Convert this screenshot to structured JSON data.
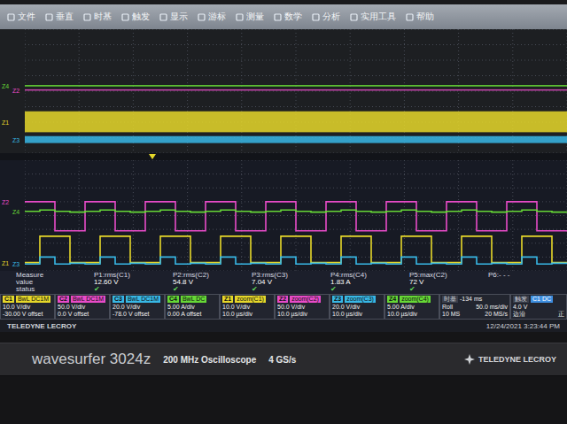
{
  "menu": [
    {
      "label": "文件"
    },
    {
      "label": "垂直"
    },
    {
      "label": "时基"
    },
    {
      "label": "触发"
    },
    {
      "label": "显示"
    },
    {
      "label": "游标"
    },
    {
      "label": "测量"
    },
    {
      "label": "数学"
    },
    {
      "label": "分析"
    },
    {
      "label": "实用工具"
    },
    {
      "label": "帮助"
    }
  ],
  "overview": {
    "series": [
      {
        "label": "Z4",
        "color": "#66d836",
        "top": 0.4,
        "bottom": 0.3
      },
      {
        "label": "Z2",
        "color": "#e84bc8",
        "top": 0.12,
        "bottom": 0.04
      },
      {
        "label": "Z1",
        "color": "#e6d82a",
        "top": -1.3,
        "bottom": -2.65
      },
      {
        "label": "Z3",
        "color": "#38b8e6",
        "top": -2.9,
        "bottom": -3.35
      }
    ]
  },
  "zoom": {
    "units": "divisions",
    "series": [
      {
        "label": "Z2",
        "color": "#e84bc8",
        "values": [
          1.0,
          1.0,
          -1.1,
          -1.1,
          1.0,
          1.0,
          -1.1,
          -1.1,
          1.0,
          1.0,
          -1.1,
          -1.1,
          1.0,
          1.0,
          -1.1,
          -1.1,
          1.0,
          1.0,
          -1.1,
          -1.1,
          1.0,
          1.0,
          -1.1,
          -1.1,
          1.0,
          1.0,
          -1.1,
          -1.1,
          1.0,
          1.0,
          -1.1,
          -1.1,
          1.0,
          1.0,
          -1.1,
          -1.1
        ]
      },
      {
        "label": "Z4",
        "color": "#66d836",
        "values": [
          0.3,
          0.4,
          0.3,
          0.25,
          0.3,
          0.4,
          0.3,
          0.25,
          0.3,
          0.4,
          0.3,
          0.25,
          0.3,
          0.4,
          0.3,
          0.25,
          0.3,
          0.4,
          0.3,
          0.25,
          0.3,
          0.4,
          0.3,
          0.25,
          0.3,
          0.4,
          0.3,
          0.25,
          0.3,
          0.4,
          0.3,
          0.25,
          0.3,
          0.4,
          0.3,
          0.25
        ]
      },
      {
        "label": "Z1",
        "color": "#e6d82a",
        "values": [
          -3.4,
          -1.5,
          -1.5,
          -3.4,
          -3.4,
          -1.5,
          -1.5,
          -3.4,
          -3.4,
          -1.5,
          -1.5,
          -3.4,
          -3.4,
          -1.5,
          -1.5,
          -3.4,
          -3.4,
          -1.5,
          -1.5,
          -3.4,
          -3.4,
          -1.5,
          -1.5,
          -3.4,
          -3.4,
          -1.5,
          -1.5,
          -3.4,
          -3.4,
          -1.5,
          -1.5,
          -3.4,
          -3.4,
          -1.5,
          -1.5,
          -3.4
        ]
      },
      {
        "label": "Z3",
        "color": "#38b8e6",
        "values": [
          -3.5,
          -3.0,
          -3.5,
          -3.45,
          -3.5,
          -3.0,
          -3.5,
          -3.45,
          -3.5,
          -3.0,
          -3.5,
          -3.45,
          -3.5,
          -3.0,
          -3.5,
          -3.45,
          -3.5,
          -3.0,
          -3.5,
          -3.45,
          -3.5,
          -3.0,
          -3.5,
          -3.45,
          -3.5,
          -3.0,
          -3.5,
          -3.45,
          -3.5,
          -3.0,
          -3.5,
          -3.45,
          -3.5,
          -3.0,
          -3.5,
          -3.45
        ]
      }
    ]
  },
  "measure": {
    "labels": [
      "Measure",
      "value",
      "status"
    ],
    "params": [
      {
        "name": "P1:rms(C1)",
        "value": "12.60 V",
        "ok": true,
        "mark": "✔"
      },
      {
        "name": "P2:rms(C2)",
        "value": "54.8 V",
        "ok": true,
        "mark": "✔"
      },
      {
        "name": "P3:rms(C3)",
        "value": "7.04 V",
        "ok": true,
        "mark": "✔"
      },
      {
        "name": "P4:rms(C4)",
        "value": "1.83 A",
        "ok": true,
        "mark": "✔"
      },
      {
        "name": "P5:max(C2)",
        "value": "72 V",
        "ok": true,
        "mark": "✔"
      },
      {
        "name": "P6:- - -",
        "value": "",
        "ok": false,
        "mark": ""
      }
    ]
  },
  "descriptors": [
    {
      "tag": "C1",
      "info": "BwL DC1M",
      "lines": [
        "10.0 V/div",
        "-30.00 V offset"
      ],
      "color": "#e6d82a"
    },
    {
      "tag": "C2",
      "info": "BwL DC1M",
      "lines": [
        "50.0 V/div",
        "0.0 V offset"
      ],
      "color": "#e84bc8"
    },
    {
      "tag": "C3",
      "info": "BwL DC1M",
      "lines": [
        "20.0 V/div",
        "-78.0 V offset"
      ],
      "color": "#38b8e6"
    },
    {
      "tag": "C4",
      "info": "BwL DC",
      "lines": [
        "5.00 A/div",
        "0.00 A offset"
      ],
      "color": "#66d836"
    },
    {
      "tag": "Z1",
      "info": "zoom(C1)",
      "lines": [
        "10.0 V/div",
        "10.0 µs/div"
      ],
      "color": "#e6d82a"
    },
    {
      "tag": "Z2",
      "info": "zoom(C2)",
      "lines": [
        "50.0 V/div",
        "10.0 µs/div"
      ],
      "color": "#e84bc8"
    },
    {
      "tag": "Z3",
      "info": "zoom(C3)",
      "lines": [
        "20.0 V/div",
        "10.0 µs/div"
      ],
      "color": "#38b8e6"
    },
    {
      "tag": "Z4",
      "info": "zoom(C4)",
      "lines": [
        "5.00 A/div",
        "10.0 µs/div"
      ],
      "color": "#66d836"
    }
  ],
  "timebase": {
    "title": "时基",
    "delay": "-134 ms",
    "mode": "Roll",
    "scale": "50.0 ms/div",
    "samples": "10 MS",
    "rate": "20 MS/s"
  },
  "trigger": {
    "title": "触发",
    "source": "C1 DC",
    "level": "4.0 V",
    "type": "边沿",
    "slope": "正"
  },
  "footer": {
    "brand": "TELEDYNE LECROY",
    "datetime": "12/24/2021 3:23:44 PM"
  },
  "bezel": {
    "model": "wavesurfer 3024z",
    "bandwidth": "200 MHz Oscilloscope",
    "rate": "4 GS/s",
    "logo": "TELEDYNE LECROY"
  }
}
